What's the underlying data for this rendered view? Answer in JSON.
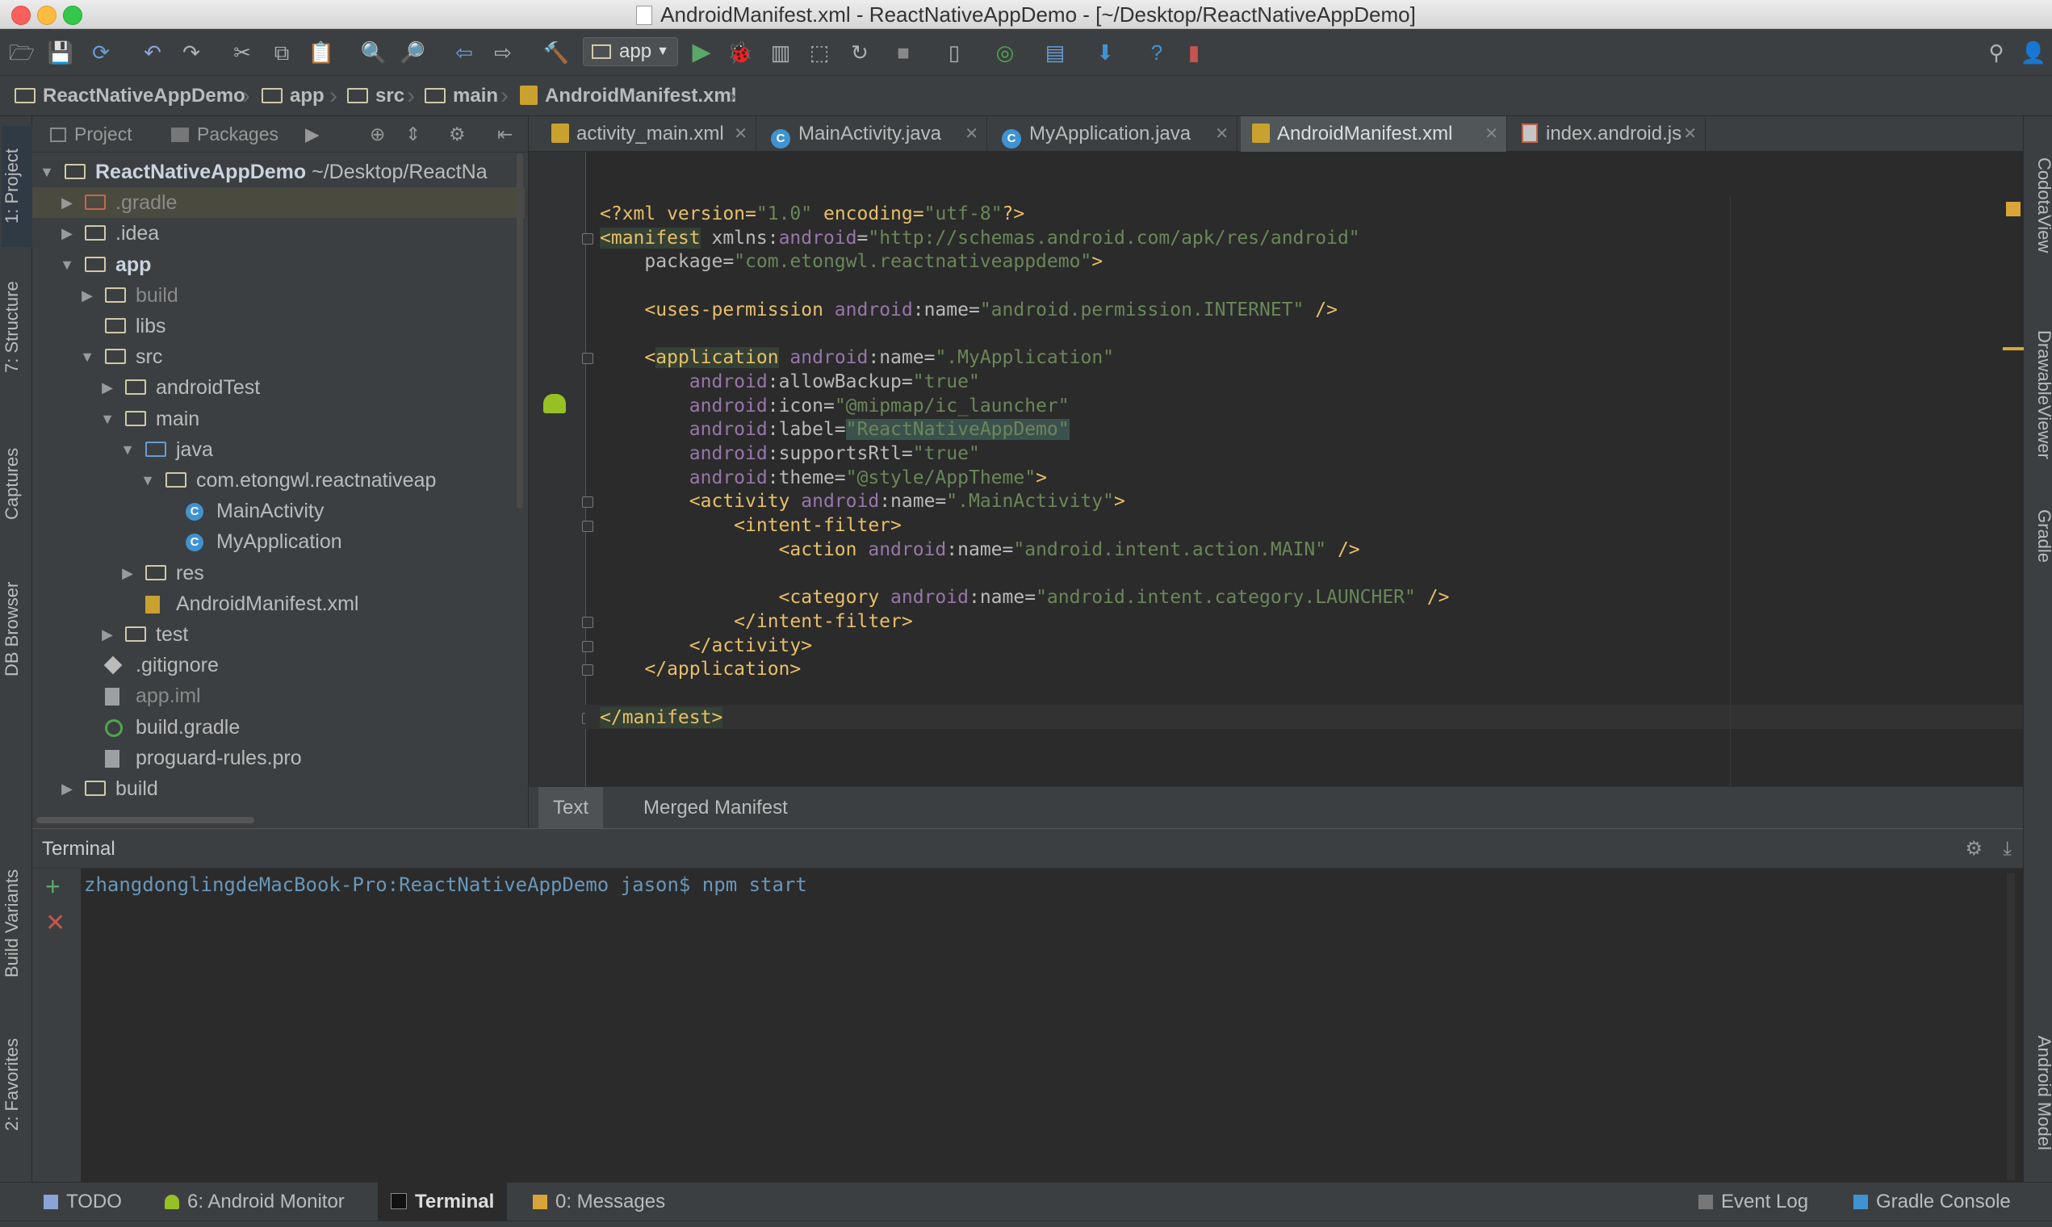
{
  "window": {
    "title": "AndroidManifest.xml - ReactNativeAppDemo - [~/Desktop/ReactNativeAppDemo]"
  },
  "toolbar": {
    "run_config": "app"
  },
  "breadcrumb": [
    "ReactNativeAppDemo",
    "app",
    "src",
    "main",
    "AndroidManifest.xml"
  ],
  "project_panel": {
    "tabs": [
      "Project",
      "Packages"
    ],
    "tree": [
      {
        "label": "ReactNativeAppDemo",
        "suffix": "~/Desktop/ReactNa",
        "depth": 0,
        "arrow": "down",
        "icon": "module-folder-icon",
        "bold": true
      },
      {
        "label": ".gradle",
        "depth": 1,
        "arrow": "right",
        "icon": "folder-icon-excluded",
        "dim": true,
        "selected": true
      },
      {
        "label": ".idea",
        "depth": 1,
        "arrow": "right",
        "icon": "folder-icon"
      },
      {
        "label": "app",
        "depth": 1,
        "arrow": "down",
        "icon": "module-folder-icon",
        "bold": true
      },
      {
        "label": "build",
        "depth": 2,
        "arrow": "right",
        "icon": "folder-icon",
        "dim": true
      },
      {
        "label": "libs",
        "depth": 2,
        "arrow": "",
        "icon": "folder-icon"
      },
      {
        "label": "src",
        "depth": 2,
        "arrow": "down",
        "icon": "folder-icon"
      },
      {
        "label": "androidTest",
        "depth": 3,
        "arrow": "right",
        "icon": "folder-icon"
      },
      {
        "label": "main",
        "depth": 3,
        "arrow": "down",
        "icon": "folder-icon"
      },
      {
        "label": "java",
        "depth": 4,
        "arrow": "down",
        "icon": "source-folder-icon"
      },
      {
        "label": "com.etongwl.reactnativeap",
        "depth": 5,
        "arrow": "down",
        "icon": "package-icon"
      },
      {
        "label": "MainActivity",
        "depth": 6,
        "arrow": "",
        "icon": "class-icon"
      },
      {
        "label": "MyApplication",
        "depth": 6,
        "arrow": "",
        "icon": "class-icon"
      },
      {
        "label": "res",
        "depth": 4,
        "arrow": "right",
        "icon": "resource-folder-icon"
      },
      {
        "label": "AndroidManifest.xml",
        "depth": 4,
        "arrow": "",
        "icon": "manifest-file-icon"
      },
      {
        "label": "test",
        "depth": 3,
        "arrow": "right",
        "icon": "folder-icon"
      },
      {
        "label": ".gitignore",
        "depth": 2,
        "arrow": "",
        "icon": "gitignore-file-icon"
      },
      {
        "label": "app.iml",
        "depth": 2,
        "arrow": "",
        "icon": "iml-file-icon",
        "dim": true
      },
      {
        "label": "build.gradle",
        "depth": 2,
        "arrow": "",
        "icon": "gradle-file-icon"
      },
      {
        "label": "proguard-rules.pro",
        "depth": 2,
        "arrow": "",
        "icon": "text-file-icon"
      },
      {
        "label": "build",
        "depth": 1,
        "arrow": "right",
        "icon": "folder-icon"
      }
    ]
  },
  "editor_tabs": [
    {
      "label": "activity_main.xml",
      "icon": "xml-file-icon",
      "active": false
    },
    {
      "label": "MainActivity.java",
      "icon": "java-class-icon",
      "active": false
    },
    {
      "label": "MyApplication.java",
      "icon": "java-class-icon",
      "active": false
    },
    {
      "label": "AndroidManifest.xml",
      "icon": "manifest-file-icon",
      "active": true
    },
    {
      "label": "index.android.js",
      "icon": "js-file-icon",
      "active": false
    }
  ],
  "code_lines": [
    [
      [
        "pi",
        "<?xml version="
      ],
      [
        "val",
        "\"1.0\""
      ],
      [
        "pi",
        " encoding="
      ],
      [
        "val",
        "\"utf-8\""
      ],
      [
        "pi",
        "?>"
      ]
    ],
    [
      [
        "taghl",
        "<manifest"
      ],
      [
        "attr",
        " xmlns:"
      ],
      [
        "ns",
        "android"
      ],
      [
        "attr",
        "="
      ],
      [
        "val",
        "\"http://schemas.android.com/apk/res/android\""
      ]
    ],
    [
      [
        "attr",
        "    package="
      ],
      [
        "val",
        "\"com.etongwl.reactnativeappdemo\""
      ],
      [
        "tag",
        ">"
      ]
    ],
    [],
    [
      [
        "tag",
        "    <uses-permission"
      ],
      [
        "ns",
        " android"
      ],
      [
        "attr",
        ":name="
      ],
      [
        "val",
        "\"android.permission.INTERNET\""
      ],
      [
        "tag",
        " />"
      ]
    ],
    [],
    [
      [
        "tag",
        "    <"
      ],
      [
        "taghl2",
        "application"
      ],
      [
        "ns",
        " android"
      ],
      [
        "attr",
        ":name="
      ],
      [
        "val",
        "\".MyApplication\""
      ]
    ],
    [
      [
        "ns",
        "        android"
      ],
      [
        "attr",
        ":allowBackup="
      ],
      [
        "val",
        "\"true\""
      ]
    ],
    [
      [
        "ns",
        "        android"
      ],
      [
        "attr",
        ":icon="
      ],
      [
        "val",
        "\"@mipmap/ic_launcher\""
      ]
    ],
    [
      [
        "ns",
        "        android"
      ],
      [
        "attr",
        ":label="
      ],
      [
        "valhl",
        "\"ReactNativeAppDemo\""
      ]
    ],
    [
      [
        "ns",
        "        android"
      ],
      [
        "attr",
        ":supportsRtl="
      ],
      [
        "val",
        "\"true\""
      ]
    ],
    [
      [
        "ns",
        "        android"
      ],
      [
        "attr",
        ":theme="
      ],
      [
        "val",
        "\"@style/AppTheme\""
      ],
      [
        "tag",
        ">"
      ]
    ],
    [
      [
        "tag",
        "        <activity"
      ],
      [
        "ns",
        " android"
      ],
      [
        "attr",
        ":name="
      ],
      [
        "val",
        "\".MainActivity\""
      ],
      [
        "tag",
        ">"
      ]
    ],
    [
      [
        "tag",
        "            <intent-filter>"
      ]
    ],
    [
      [
        "tag",
        "                <action"
      ],
      [
        "ns",
        " android"
      ],
      [
        "attr",
        ":name="
      ],
      [
        "val",
        "\"android.intent.action.MAIN\""
      ],
      [
        "tag",
        " />"
      ]
    ],
    [],
    [
      [
        "tag",
        "                <category"
      ],
      [
        "ns",
        " android"
      ],
      [
        "attr",
        ":name="
      ],
      [
        "val",
        "\"android.intent.category.LAUNCHER\""
      ],
      [
        "tag",
        " />"
      ]
    ],
    [
      [
        "tag",
        "            </intent-filter>"
      ]
    ],
    [
      [
        "tag",
        "        </activity>"
      ]
    ],
    [
      [
        "tag",
        "    </application>"
      ]
    ],
    [],
    [
      [
        "taghl",
        "</manifest>"
      ]
    ]
  ],
  "editor_bottom_tabs": [
    {
      "label": "Text",
      "active": true
    },
    {
      "label": "Merged Manifest",
      "active": false
    }
  ],
  "terminal": {
    "title": "Terminal",
    "prompt": "zhangdonglingdeMacBook-Pro:ReactNativeAppDemo jason$ npm start"
  },
  "left_tool_tabs": [
    "1: Project",
    "7: Structure",
    "Captures",
    "DB Browser",
    "Build Variants",
    "2: Favorites"
  ],
  "right_tool_tabs": [
    "CodotaView",
    "DrawableViewer",
    "Gradle",
    "Android Model"
  ],
  "bottom_tools": [
    {
      "label": "TODO",
      "icon": "todo-icon"
    },
    {
      "label": "6: Android Monitor",
      "icon": "android-icon"
    },
    {
      "label": "Terminal",
      "icon": "terminal-icon",
      "active": true
    },
    {
      "label": "0: Messages",
      "icon": "messages-icon"
    },
    {
      "label": "Event Log",
      "icon": "event-log-icon"
    },
    {
      "label": "Gradle Console",
      "icon": "gradle-console-icon"
    }
  ],
  "colors": {
    "background": "#2b2b2b",
    "panel": "#3c3f41",
    "xml_tag": "#e8bf6a",
    "xml_value": "#6a8759",
    "namespace": "#9876aa",
    "terminal_text": "#6897bb"
  }
}
